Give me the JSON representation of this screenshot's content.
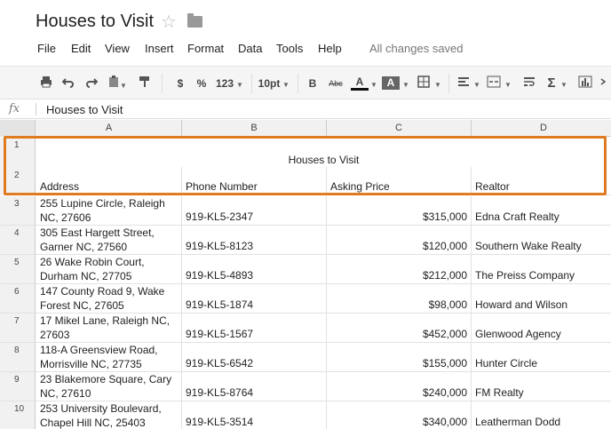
{
  "title_bar": {
    "doc_title": "Houses to Visit"
  },
  "menu": {
    "items": [
      "File",
      "Edit",
      "View",
      "Insert",
      "Format",
      "Data",
      "Tools",
      "Help"
    ],
    "status": "All changes saved"
  },
  "toolbar": {
    "currency": "$",
    "percent": "%",
    "number_format": "123",
    "font_size": "10pt",
    "bold": "B",
    "strikethrough": "Abc",
    "text_color": "A",
    "fill_color": "A",
    "sum": "Σ"
  },
  "formula_bar": {
    "fx": "fx",
    "value": "Houses to Visit"
  },
  "columns": [
    "A",
    "B",
    "C",
    "D"
  ],
  "sheet": {
    "title": "Houses to Visit",
    "headers": {
      "address": "Address",
      "phone": "Phone Number",
      "price": "Asking Price",
      "realtor": "Realtor"
    },
    "rows": [
      {
        "num": "3",
        "address": "255 Lupine Circle, Raleigh NC, 27606",
        "phone": "919-KL5-2347",
        "price": "$315,000",
        "realtor": "Edna Craft Realty"
      },
      {
        "num": "4",
        "address": "305 East Hargett Street, Garner NC, 27560",
        "phone": "919-KL5-8123",
        "price": "$120,000",
        "realtor": "Southern Wake Realty"
      },
      {
        "num": "5",
        "address": "26 Wake Robin Court, Durham NC, 27705",
        "phone": "919-KL5-4893",
        "price": "$212,000",
        "realtor": "The Preiss Company"
      },
      {
        "num": "6",
        "address": "147 County Road 9, Wake Forest NC, 27605",
        "phone": "919-KL5-1874",
        "price": "$98,000",
        "realtor": "Howard and Wilson"
      },
      {
        "num": "7",
        "address": "17 Mikel Lane, Raleigh NC, 27603",
        "phone": "919-KL5-1567",
        "price": "$452,000",
        "realtor": "Glenwood Agency"
      },
      {
        "num": "8",
        "address": "118-A Greensview Road, Morrisville NC, 27735",
        "phone": "919-KL5-6542",
        "price": "$155,000",
        "realtor": "Hunter Circle"
      },
      {
        "num": "9",
        "address": "23 Blakemore Square, Cary NC, 27610",
        "phone": "919-KL5-8764",
        "price": "$240,000",
        "realtor": "FM Realty"
      },
      {
        "num": "10",
        "address": "253 University Boulevard, Chapel Hill NC, 25403",
        "phone": "919-KL5-3514",
        "price": "$340,000",
        "realtor": "Leatherman Dodd"
      }
    ]
  },
  "row_numbers": {
    "r1": "1",
    "r2": "2"
  },
  "colors": {
    "highlight": "#e07b22"
  }
}
